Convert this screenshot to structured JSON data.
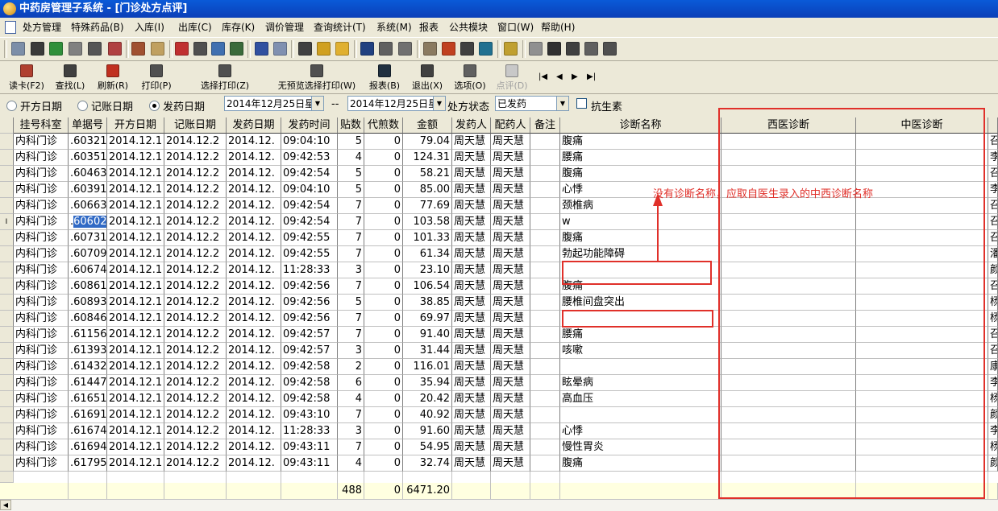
{
  "window": {
    "title": "中药房管理子系统 - [门诊处方点评]"
  },
  "menu": [
    "处方管理",
    "特殊药品(B)",
    "入库(I)",
    "出库(C)",
    "库存(K)",
    "调价管理",
    "查询统计(T)",
    "系统(M)",
    "报表",
    "公共模块",
    "窗口(W)",
    "帮助(H)"
  ],
  "toolbar_buttons": [
    {
      "label": "读卡(F2)"
    },
    {
      "label": "查找(L)"
    },
    {
      "label": "刷新(R)"
    },
    {
      "label": "打印(P)"
    },
    {
      "label": "选择打印(Z)"
    },
    {
      "label": "无预览选择打印(W)"
    },
    {
      "label": "报表(B)"
    },
    {
      "label": "退出(X)"
    },
    {
      "label": "选项(O)"
    },
    {
      "label": "点评(D)"
    }
  ],
  "nav": {
    "first": "|◀",
    "prev": "◀",
    "next": "▶",
    "last": "▶|"
  },
  "filter": {
    "radio_open_date": "开方日期",
    "radio_account_date": "记账日期",
    "radio_dispense_date": "发药日期",
    "selected_radio": "发药日期",
    "date_from": "2014年12月25日星",
    "separator": "--",
    "date_to": "2014年12月25日星",
    "status_label": "处方状态",
    "status_value": "已发药",
    "antibiotic_label": "抗生素"
  },
  "table": {
    "columns": [
      "挂号科室",
      "单据号",
      "开方日期",
      "记账日期",
      "发药日期",
      "发药时间",
      "贴数",
      "代煎数",
      "金额",
      "发药人",
      "配药人",
      "备注",
      "诊断名称",
      "西医诊断",
      "中医诊断"
    ],
    "rows": [
      [
        "内科门诊",
        ".60321",
        "2014.12.1",
        "2014.12.2",
        "2014.12.",
        "09:04:10",
        "5",
        "0",
        "79.04",
        "周天慧",
        "周天慧",
        "",
        "腹痛",
        "",
        "",
        "召"
      ],
      [
        "内科门诊",
        ".60351",
        "2014.12.1",
        "2014.12.2",
        "2014.12.",
        "09:42:53",
        "4",
        "0",
        "124.31",
        "周天慧",
        "周天慧",
        "",
        "腰痛",
        "",
        "",
        "李"
      ],
      [
        "内科门诊",
        ".60463",
        "2014.12.1",
        "2014.12.2",
        "2014.12.",
        "09:42:54",
        "5",
        "0",
        "58.21",
        "周天慧",
        "周天慧",
        "",
        "腹痛",
        "",
        "",
        "召"
      ],
      [
        "内科门诊",
        ".60391",
        "2014.12.1",
        "2014.12.2",
        "2014.12.",
        "09:04:10",
        "5",
        "0",
        "85.00",
        "周天慧",
        "周天慧",
        "",
        "心悸",
        "",
        "",
        "李"
      ],
      [
        "内科门诊",
        ".60663",
        "2014.12.1",
        "2014.12.2",
        "2014.12.",
        "09:42:54",
        "7",
        "0",
        "77.69",
        "周天慧",
        "周天慧",
        "",
        "颈椎病",
        "",
        "",
        "召"
      ],
      [
        "内科门诊",
        ".60602",
        "2014.12.1",
        "2014.12.2",
        "2014.12.",
        "09:42:54",
        "7",
        "0",
        "103.58",
        "周天慧",
        "周天慧",
        "",
        "w",
        "",
        "",
        "召"
      ],
      [
        "内科门诊",
        ".60731",
        "2014.12.1",
        "2014.12.2",
        "2014.12.",
        "09:42:55",
        "7",
        "0",
        "101.33",
        "周天慧",
        "周天慧",
        "",
        "腹痛",
        "",
        "",
        "召"
      ],
      [
        "内科门诊",
        ".60709",
        "2014.12.1",
        "2014.12.2",
        "2014.12.",
        "09:42:55",
        "7",
        "0",
        "61.34",
        "周天慧",
        "周天慧",
        "",
        "勃起功能障碍",
        "",
        "",
        "潘"
      ],
      [
        "内科门诊",
        ".60674",
        "2014.12.1",
        "2014.12.2",
        "2014.12.",
        "11:28:33",
        "3",
        "0",
        "23.10",
        "周天慧",
        "周天慧",
        "",
        "",
        "",
        "",
        "颜"
      ],
      [
        "内科门诊",
        ".60861",
        "2014.12.1",
        "2014.12.2",
        "2014.12.",
        "09:42:56",
        "7",
        "0",
        "106.54",
        "周天慧",
        "周天慧",
        "",
        "腹痛",
        "",
        "",
        "召"
      ],
      [
        "内科门诊",
        ".60893",
        "2014.12.1",
        "2014.12.2",
        "2014.12.",
        "09:42:56",
        "5",
        "0",
        "38.85",
        "周天慧",
        "周天慧",
        "",
        "腰椎间盘突出",
        "",
        "",
        "杨"
      ],
      [
        "内科门诊",
        ".60846",
        "2014.12.1",
        "2014.12.2",
        "2014.12.",
        "09:42:56",
        "7",
        "0",
        "69.97",
        "周天慧",
        "周天慧",
        "",
        "",
        "",
        "",
        "杨"
      ],
      [
        "内科门诊",
        ".61156",
        "2014.12.1",
        "2014.12.2",
        "2014.12.",
        "09:42:57",
        "7",
        "0",
        "91.40",
        "周天慧",
        "周天慧",
        "",
        "腰痛",
        "",
        "",
        "召"
      ],
      [
        "内科门诊",
        ".61393",
        "2014.12.1",
        "2014.12.2",
        "2014.12.",
        "09:42:57",
        "3",
        "0",
        "31.44",
        "周天慧",
        "周天慧",
        "",
        "咳嗽",
        "",
        "",
        "召"
      ],
      [
        "内科门诊",
        ".61432",
        "2014.12.1",
        "2014.12.2",
        "2014.12.",
        "09:42:58",
        "2",
        "0",
        "116.01",
        "周天慧",
        "周天慧",
        "",
        "",
        "",
        "",
        "康"
      ],
      [
        "内科门诊",
        ".61447",
        "2014.12.1",
        "2014.12.2",
        "2014.12.",
        "09:42:58",
        "6",
        "0",
        "35.94",
        "周天慧",
        "周天慧",
        "",
        "眩晕病",
        "",
        "",
        "李"
      ],
      [
        "内科门诊",
        ".61651",
        "2014.12.1",
        "2014.12.2",
        "2014.12.",
        "09:42:58",
        "4",
        "0",
        "20.42",
        "周天慧",
        "周天慧",
        "",
        "高血压",
        "",
        "",
        "杨"
      ],
      [
        "内科门诊",
        ".61691",
        "2014.12.1",
        "2014.12.2",
        "2014.12.",
        "09:43:10",
        "7",
        "0",
        "40.92",
        "周天慧",
        "周天慧",
        "",
        "",
        "",
        "",
        "颜"
      ],
      [
        "内科门诊",
        ".61674",
        "2014.12.1",
        "2014.12.2",
        "2014.12.",
        "11:28:33",
        "3",
        "0",
        "91.60",
        "周天慧",
        "周天慧",
        "",
        "心悸",
        "",
        "",
        "李"
      ],
      [
        "内科门诊",
        ".61694",
        "2014.12.1",
        "2014.12.2",
        "2014.12.",
        "09:43:11",
        "7",
        "0",
        "54.95",
        "周天慧",
        "周天慧",
        "",
        "慢性胃炎",
        "",
        "",
        "杨"
      ],
      [
        "内科门诊",
        ".61795",
        "2014.12.1",
        "2014.12.2",
        "2014.12.",
        "09:43:11",
        "4",
        "0",
        "32.74",
        "周天慧",
        "周天慧",
        "",
        "腹痛",
        "",
        "",
        "颜"
      ]
    ],
    "selected_row": 5,
    "selected_cell_value": "60602",
    "row_indicator_current": "I",
    "footer": {
      "tie_total": "488",
      "daijian_total": "0",
      "amount_total": "6471.20"
    }
  },
  "annotation": {
    "note": "没有诊断名称，应取自医生录入的中西诊断名称",
    "color": "#e0302a"
  }
}
